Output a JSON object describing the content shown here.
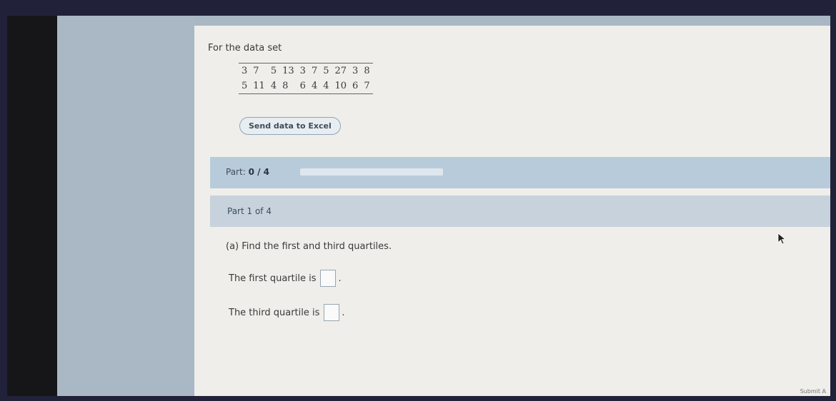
{
  "problem": {
    "intro": "For the data set",
    "data_rows": [
      [
        "3",
        "7",
        "5",
        "13",
        "3",
        "7",
        "5",
        "27",
        "3",
        "8"
      ],
      [
        "5",
        "11",
        "4",
        "8",
        "6",
        "4",
        "4",
        "10",
        "6",
        "7"
      ]
    ],
    "excel_button_label": "Send data to Excel"
  },
  "progress": {
    "part_prefix": "Part:",
    "part_value": "0 / 4",
    "fraction_complete": 0
  },
  "part1": {
    "header": "Part 1 of 4",
    "question": "(a) Find the first and third quartiles.",
    "first_quartile_label": "The first quartile is",
    "third_quartile_label": "The third quartile is",
    "first_quartile_value": "",
    "third_quartile_value": "",
    "sentence_end": "."
  },
  "footer": {
    "partial_text": "Submit A"
  }
}
